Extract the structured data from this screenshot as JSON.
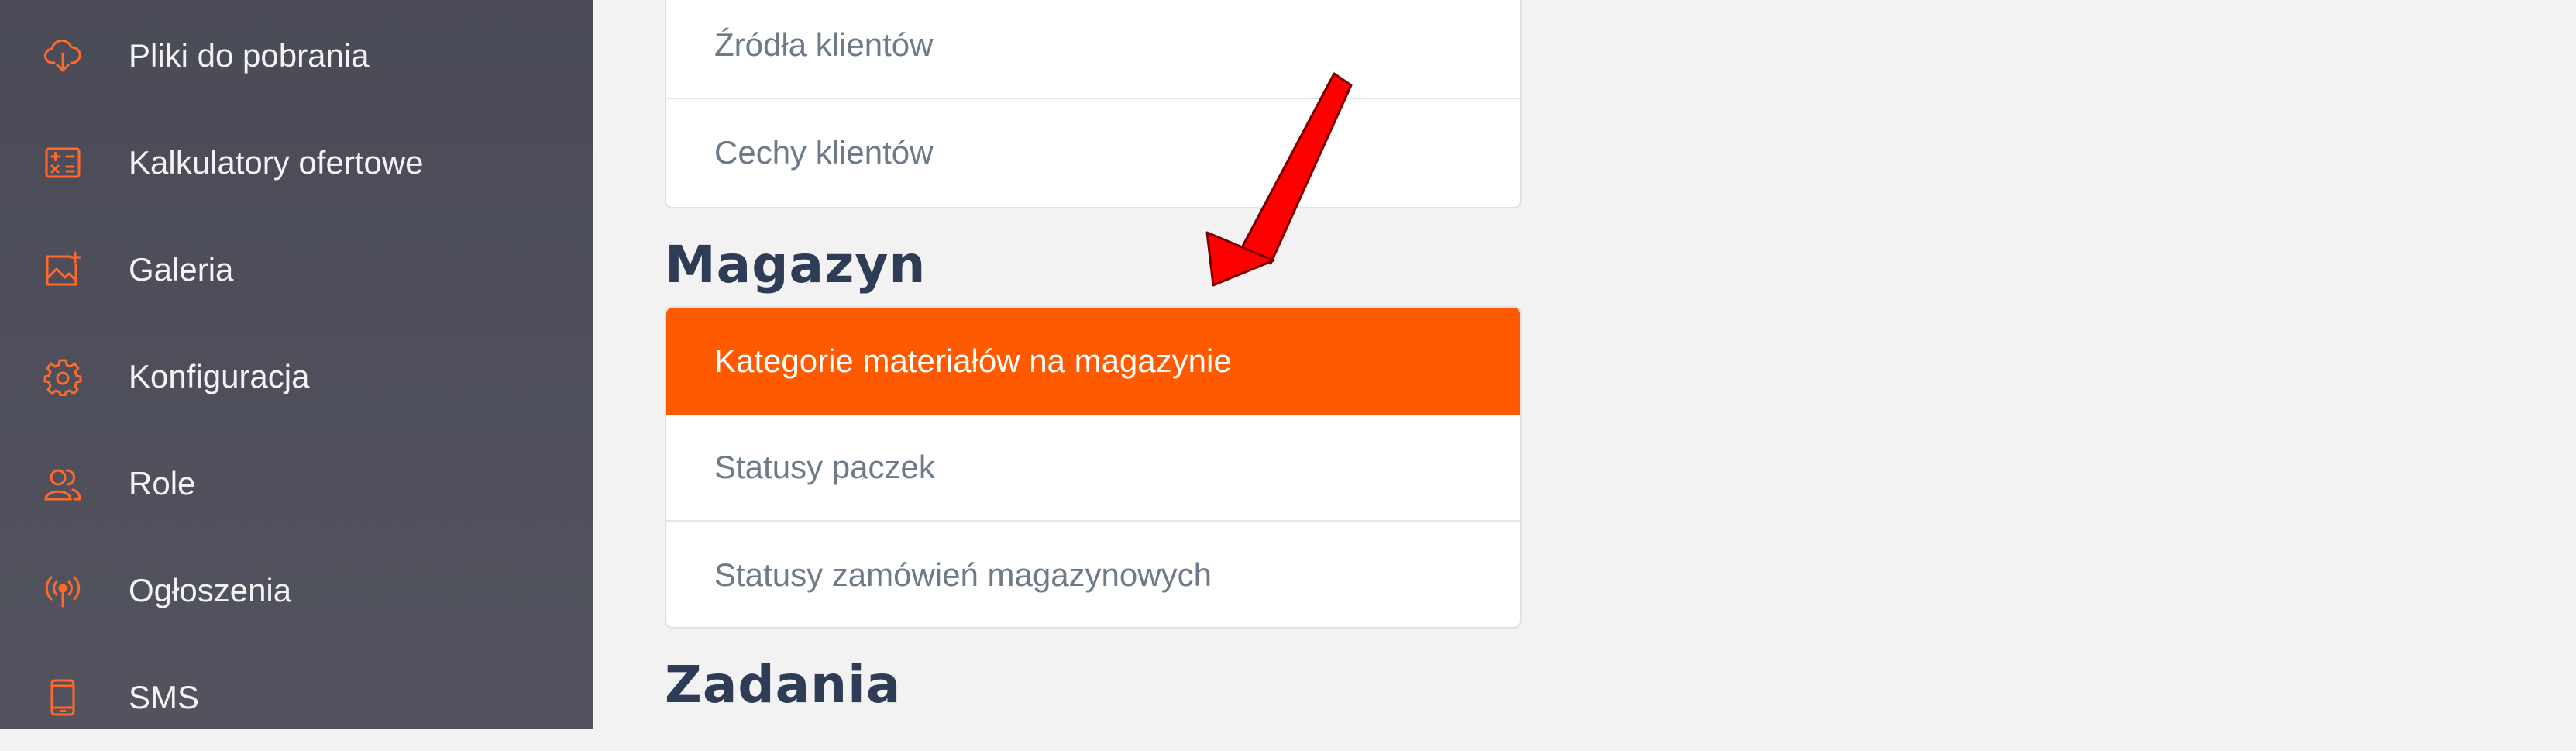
{
  "sidebar": {
    "accent_color": "#ff6a2b",
    "items": [
      {
        "label": "Pliki do pobrania",
        "icon": "cloud-download-icon"
      },
      {
        "label": "Kalkulatory ofertowe",
        "icon": "calculator-icon"
      },
      {
        "label": "Galeria",
        "icon": "image-add-icon"
      },
      {
        "label": "Konfiguracja",
        "icon": "gear-icon"
      },
      {
        "label": "Role",
        "icon": "users-icon"
      },
      {
        "label": "Ogłoszenia",
        "icon": "broadcast-icon"
      },
      {
        "label": "SMS",
        "icon": "phone-icon"
      }
    ]
  },
  "main": {
    "top_card": {
      "items": [
        "Źródła klientów",
        "Cechy klientów"
      ]
    },
    "magazyn": {
      "heading": "Magazyn",
      "items": [
        "Kategorie materiałów na magazynie",
        "Statusy paczek",
        "Statusy zamówień magazynowych"
      ],
      "active_index": 0,
      "active_color": "#ff5a00"
    },
    "zadania": {
      "heading": "Zadania"
    }
  },
  "annotation": {
    "arrow_color": "#ff0000"
  }
}
